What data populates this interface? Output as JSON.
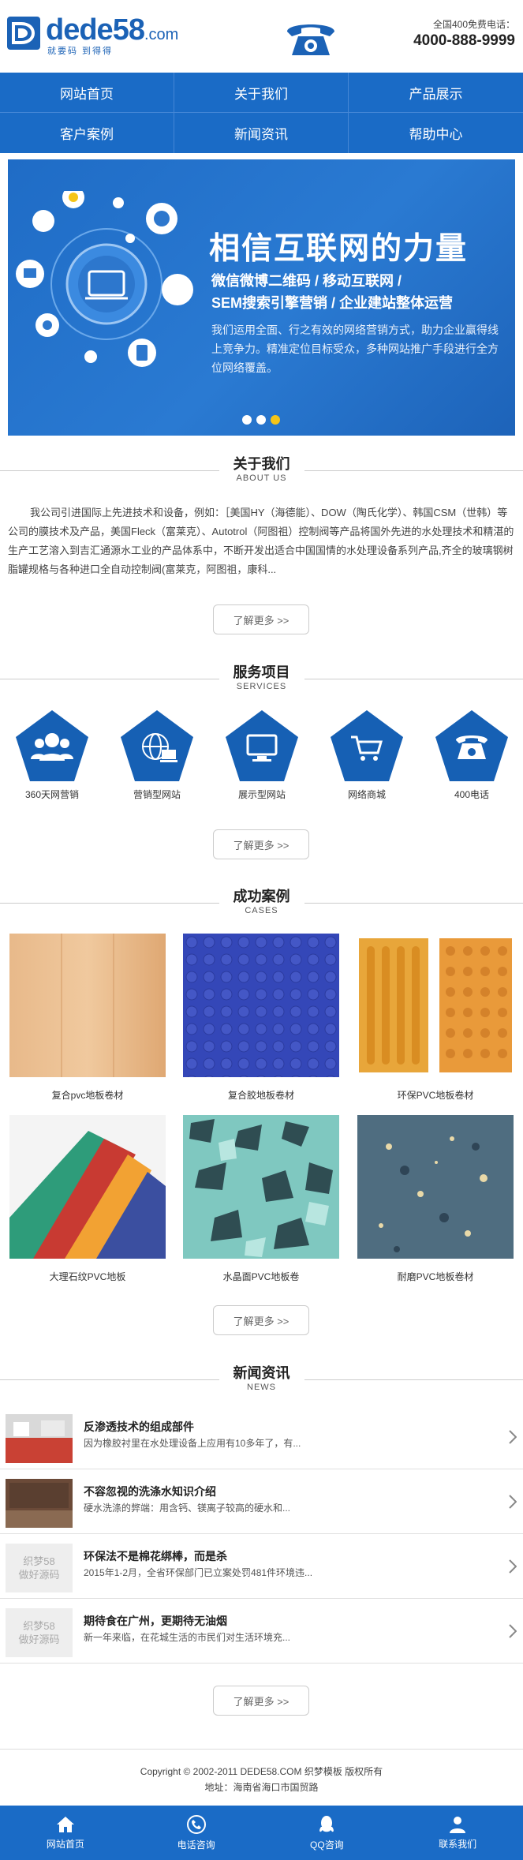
{
  "brand": {
    "name": "dede58",
    "suffix": ".com",
    "slogan": "就要码 到得得"
  },
  "hotline": {
    "label": "全国400免费电话：",
    "number": "4000-888-9999"
  },
  "nav": [
    "网站首页",
    "关于我们",
    "产品展示",
    "客户案例",
    "新闻资讯",
    "帮助中心"
  ],
  "banner": {
    "title": "相信互联网的力量",
    "sub1": "微信微博二维码 / 移动互联网 /",
    "sub2": "SEM搜索引擎营销 / 企业建站整体运营",
    "desc": "我们运用全面、行之有效的网络营销方式，助力企业赢得线上竞争力。精准定位目标受众，多种网站推广手段进行全方位网络覆盖。",
    "slides": 3,
    "active_slide": 3
  },
  "about": {
    "title": "关于我们",
    "subtitle": "ABOUT US",
    "text": "我公司引进国际上先进技术和设备，例如：［美国HY（海德能）、DOW（陶氏化学）、韩国CSM（世韩）等公司的膜技术及产品，美国Fleck（富莱克）、Autotrol（阿图祖）控制阀等产品将国外先进的水处理技术和精湛的生产工艺溶入到吉汇通源水工业的产品体系中，不断开发出适合中国国情的水处理设备系列产品,齐全的玻璃钢树脂罐规格与各种进口全自动控制阀(富莱克，阿图祖，康科...",
    "more": "了解更多 >>"
  },
  "services": {
    "title": "服务项目",
    "subtitle": "SERVICES",
    "items": [
      {
        "label": "360天网营销",
        "icon": "people-icon"
      },
      {
        "label": "营销型网站",
        "icon": "globe-computer-icon"
      },
      {
        "label": "展示型网站",
        "icon": "monitor-icon"
      },
      {
        "label": "网络商城",
        "icon": "shopping-cart-icon"
      },
      {
        "label": "400电话",
        "icon": "telephone-icon"
      }
    ],
    "more": "了解更多 >>"
  },
  "cases": {
    "title": "成功案例",
    "subtitle": "CASES",
    "items": [
      {
        "label": "复合pvc地板卷材"
      },
      {
        "label": "复合胶地板卷材"
      },
      {
        "label": "环保PVC地板卷材"
      },
      {
        "label": "大理石纹PVC地板"
      },
      {
        "label": "水晶面PVC地板卷"
      },
      {
        "label": "耐磨PVC地板卷材"
      }
    ],
    "more": "了解更多 >>"
  },
  "news": {
    "title": "新闻资讯",
    "subtitle": "NEWS",
    "items": [
      {
        "title": "反渗透技术的组成部件",
        "summary": "因为橡胶衬里在水处理设备上应用有10多年了，有..."
      },
      {
        "title": "不容忽视的洗涤水知识介绍",
        "summary": "硬水洗涤的弊端：用含钙、镁离子较高的硬水和..."
      },
      {
        "title": "环保法不是棉花绑棒，而是杀",
        "summary": "2015年1-2月，全省环保部门已立案处罚481件环境违..."
      },
      {
        "title": "期待食在广州，更期待无油烟",
        "summary": "新一年来临，在花城生活的市民们对生活环境充..."
      }
    ],
    "placeholder_text": [
      "织梦58",
      "做好源码"
    ],
    "more": "了解更多 >>"
  },
  "footer": {
    "copyright": "Copyright © 2002-2011 DEDE58.COM 织梦模板 版权所有",
    "address": "地址：海南省海口市国贸路"
  },
  "bottom_bar": [
    {
      "label": "网站首页",
      "icon": "home-icon"
    },
    {
      "label": "电话咨询",
      "icon": "phone-icon"
    },
    {
      "label": "QQ咨询",
      "icon": "qq-icon"
    },
    {
      "label": "联系我们",
      "icon": "user-icon"
    }
  ],
  "colors": {
    "primary": "#1a6bc6",
    "accent": "#f5c518"
  }
}
